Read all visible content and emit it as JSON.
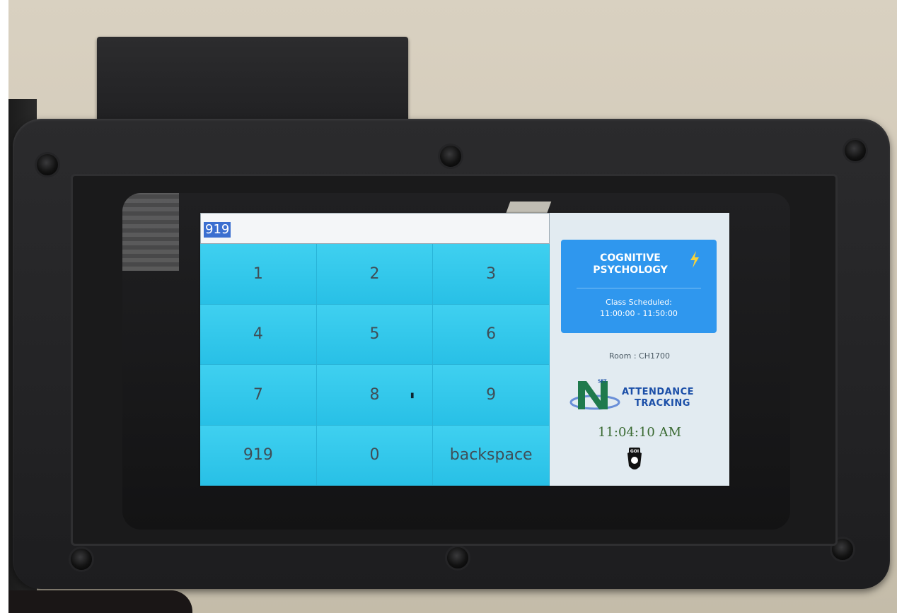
{
  "entry": {
    "value": "919"
  },
  "keypad": {
    "keys": [
      "1",
      "2",
      "3",
      "4",
      "5",
      "6",
      "7",
      "8",
      "9",
      "919",
      "0",
      "backspace"
    ]
  },
  "course": {
    "title_line1": "COGNITIVE",
    "title_line2": "PSYCHOLOGY",
    "schedule_label": "Class Scheduled:",
    "schedule_time": "11:00:00 - 11:50:00",
    "card_color": "#2f97ee"
  },
  "room": {
    "label": "Room : CH1700"
  },
  "logo": {
    "line1": "ATTENDANCE",
    "line2": "TRACKING",
    "letter": "N",
    "badge_text": "SET"
  },
  "clock": {
    "time": "11:04:10 AM"
  },
  "badge": {
    "text": "GOI"
  },
  "colors": {
    "keypad_blue": "#33c6ea",
    "selection_blue": "#3b6fd0",
    "clock_green": "#3a6a32"
  }
}
